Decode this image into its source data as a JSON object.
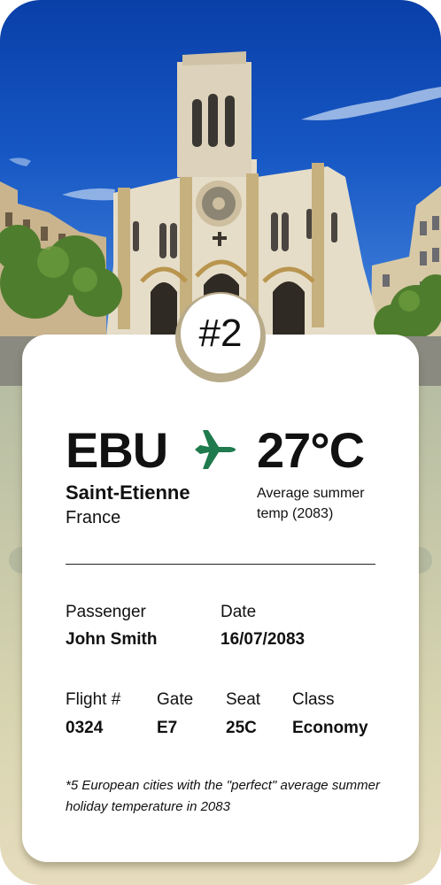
{
  "badge": "#2",
  "route": {
    "code": "EBU",
    "city": "Saint-Etienne",
    "country": "France",
    "plane_icon": "airplane-icon",
    "accent_color": "#1f7a4d"
  },
  "weather": {
    "temperature": "27°C",
    "note": "Average summer temp (2083)"
  },
  "passenger": {
    "label": "Passenger",
    "value": "John Smith"
  },
  "date": {
    "label": "Date",
    "value": "16/07/2083"
  },
  "flight": {
    "label": "Flight #",
    "value": "0324"
  },
  "gate": {
    "label": "Gate",
    "value": "E7"
  },
  "seat": {
    "label": "Seat",
    "value": "25C"
  },
  "class": {
    "label": "Class",
    "value": "Economy"
  },
  "footnote": "*5 European cities with the \"perfect\" average summer holiday temperature in 2083"
}
